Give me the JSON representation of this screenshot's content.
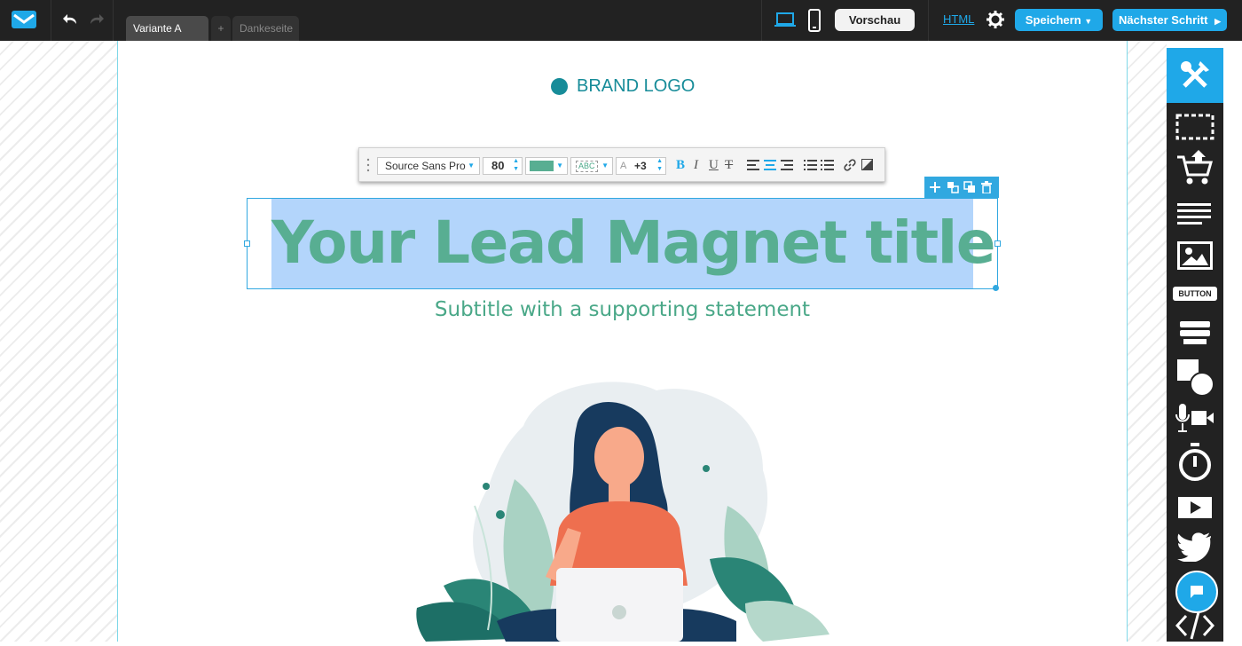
{
  "header": {
    "tabs": [
      {
        "label": "Variante A",
        "active": true
      },
      {
        "label": "+"
      },
      {
        "label": "Dankeseite"
      }
    ],
    "preview_label": "Vorschau",
    "html_label": "HTML",
    "save_label": "Speichern",
    "next_label": "Nächster Schritt"
  },
  "toolbar": {
    "font": "Source Sans Pro",
    "size": "80",
    "text_color": "#58ae92",
    "spacing_preview": "ABC",
    "letter_spacing": "+3"
  },
  "canvas": {
    "brand_logo": "BRAND LOGO",
    "title": "Your Lead Magnet title",
    "subtitle": "Subtitle with a supporting statement"
  },
  "sidebar": {
    "button_widget_label": "BUTTON",
    "items": [
      "tools-icon",
      "section-icon",
      "cart-icon",
      "text-icon",
      "image-icon",
      "button-widget",
      "form-icon",
      "shapes-icon",
      "audio-video-icon",
      "timer-icon",
      "video-icon",
      "twitter-icon",
      "code-icon"
    ]
  },
  "colors": {
    "accent": "#1fa8e8",
    "brand": "#178c99",
    "title": "#58ae92",
    "selection": "#b3d5fb"
  }
}
